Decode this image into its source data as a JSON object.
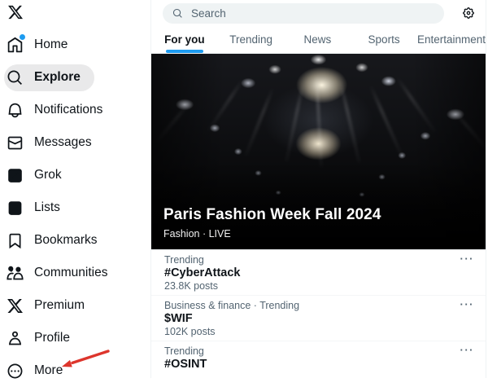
{
  "app": {
    "title": "X Explore"
  },
  "sidebar": {
    "items": [
      {
        "label": "Home",
        "icon": "home-icon",
        "active": false,
        "badge": true
      },
      {
        "label": "Explore",
        "icon": "explore-icon",
        "active": true,
        "badge": false
      },
      {
        "label": "Notifications",
        "icon": "bell-icon",
        "active": false,
        "badge": false
      },
      {
        "label": "Messages",
        "icon": "envelope-icon",
        "active": false,
        "badge": false
      },
      {
        "label": "Grok",
        "icon": "grok-icon",
        "active": false,
        "badge": false
      },
      {
        "label": "Lists",
        "icon": "list-icon",
        "active": false,
        "badge": false
      },
      {
        "label": "Bookmarks",
        "icon": "bookmark-icon",
        "active": false,
        "badge": false
      },
      {
        "label": "Communities",
        "icon": "communities-icon",
        "active": false,
        "badge": false
      },
      {
        "label": "Premium",
        "icon": "x-premium-icon",
        "active": false,
        "badge": false
      },
      {
        "label": "Profile",
        "icon": "person-icon",
        "active": false,
        "badge": false
      },
      {
        "label": "More",
        "icon": "more-circle-icon",
        "active": false,
        "badge": false
      }
    ]
  },
  "header": {
    "search_placeholder": "Search"
  },
  "tabs": [
    {
      "label": "For you",
      "active": true
    },
    {
      "label": "Trending",
      "active": false
    },
    {
      "label": "News",
      "active": false
    },
    {
      "label": "Sports",
      "active": false
    },
    {
      "label": "Entertainment",
      "active": false
    }
  ],
  "hero": {
    "title": "Paris Fashion Week Fall 2024",
    "subtitle": "Fashion · LIVE"
  },
  "trends": [
    {
      "context": "Trending",
      "title": "#CyberAttack",
      "count": "23.8K posts"
    },
    {
      "context": "Business & finance · Trending",
      "title": "$WIF",
      "count": "102K posts"
    },
    {
      "context": "Trending",
      "title": "#OSINT",
      "count": ""
    }
  ],
  "icons": {
    "ellipsis": "···"
  },
  "colors": {
    "accent_blue": "#1d9bf0",
    "text_primary": "#0f1419",
    "text_secondary": "#536471",
    "pill_background": "#e9e9ea",
    "search_background": "#eff3f4",
    "border": "#eff3f4",
    "annotation_red": "#dd352c"
  },
  "annotation": {
    "type": "arrow",
    "target": "sidebar-item-more"
  }
}
